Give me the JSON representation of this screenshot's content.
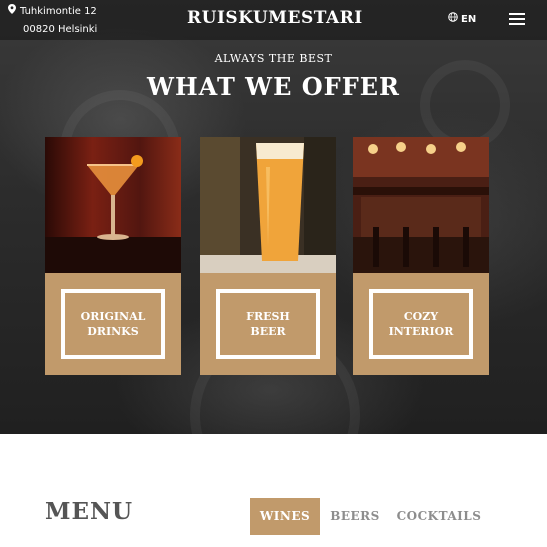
{
  "header": {
    "address_line1": "Tuhkimontie 12",
    "address_line2": "00820 Helsinki",
    "brand": "RUISKUMESTARI",
    "language": "EN",
    "icons": {
      "location": "map-pin-icon",
      "language": "globe-icon",
      "menu": "hamburger-menu-icon"
    }
  },
  "offer": {
    "kicker": "ALWAYS THE BEST",
    "title": "WHAT WE OFFER",
    "cards": [
      {
        "label": "ORIGINAL\nDRINKS"
      },
      {
        "label": "FRESH\nBEER"
      },
      {
        "label": "COZY\nINTERIOR"
      }
    ]
  },
  "menu": {
    "title": "MENU",
    "tabs": [
      {
        "label": "WINES",
        "active": true
      },
      {
        "label": "BEERS",
        "active": false
      },
      {
        "label": "COCKTAILS",
        "active": false
      }
    ]
  },
  "colors": {
    "accent": "#c19a6b",
    "header_bg": "#2a2a2a",
    "muted_text": "#8d8d8d"
  }
}
